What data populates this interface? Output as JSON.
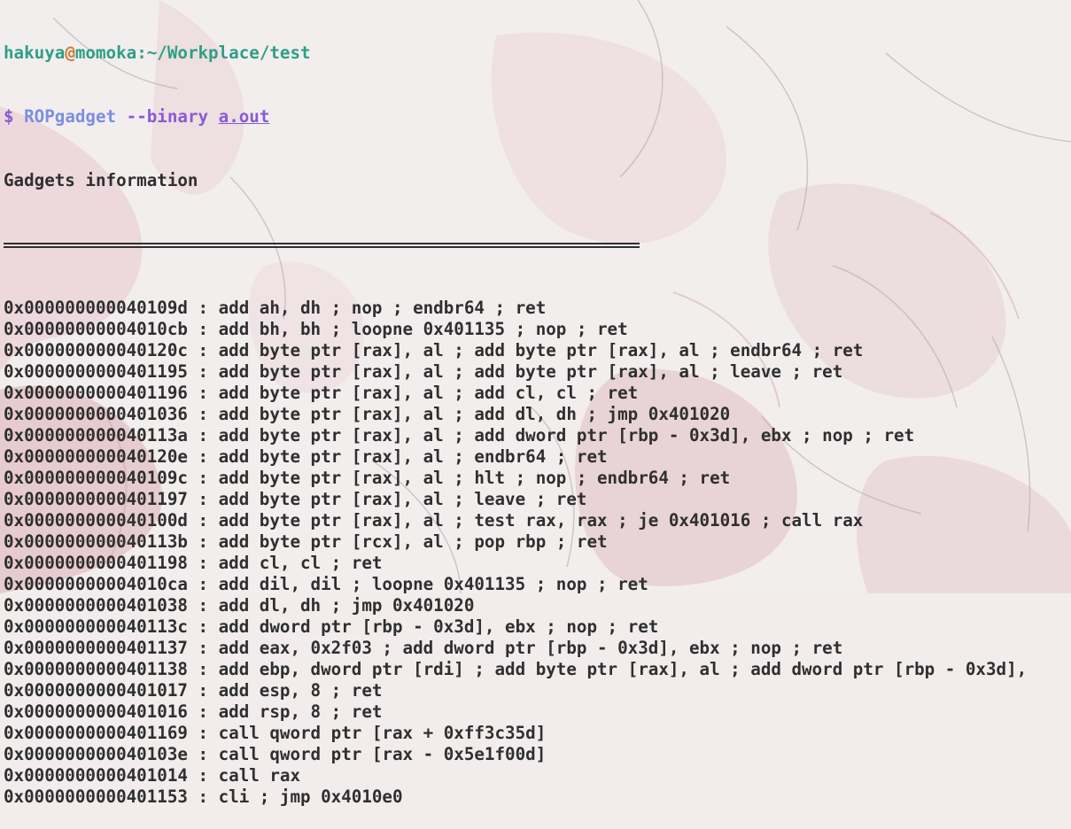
{
  "prompt": {
    "user": "hakuya",
    "at": "@",
    "host": "momoka",
    "colon": ":",
    "path": "~/Workplace/test"
  },
  "command": {
    "dollar": "$",
    "program": "ROPgadget",
    "flag": "--binary",
    "file": "a.out"
  },
  "header": "Gadgets information",
  "gadgets": [
    "0x000000000040109d : add ah, dh ; nop ; endbr64 ; ret",
    "0x00000000004010cb : add bh, bh ; loopne 0x401135 ; nop ; ret",
    "0x000000000040120c : add byte ptr [rax], al ; add byte ptr [rax], al ; endbr64 ; ret",
    "0x0000000000401195 : add byte ptr [rax], al ; add byte ptr [rax], al ; leave ; ret",
    "0x0000000000401196 : add byte ptr [rax], al ; add cl, cl ; ret",
    "0x0000000000401036 : add byte ptr [rax], al ; add dl, dh ; jmp 0x401020",
    "0x000000000040113a : add byte ptr [rax], al ; add dword ptr [rbp - 0x3d], ebx ; nop ; ret",
    "0x000000000040120e : add byte ptr [rax], al ; endbr64 ; ret",
    "0x000000000040109c : add byte ptr [rax], al ; hlt ; nop ; endbr64 ; ret",
    "0x0000000000401197 : add byte ptr [rax], al ; leave ; ret",
    "0x000000000040100d : add byte ptr [rax], al ; test rax, rax ; je 0x401016 ; call rax",
    "0x000000000040113b : add byte ptr [rcx], al ; pop rbp ; ret",
    "0x0000000000401198 : add cl, cl ; ret",
    "0x00000000004010ca : add dil, dil ; loopne 0x401135 ; nop ; ret",
    "0x0000000000401038 : add dl, dh ; jmp 0x401020",
    "0x000000000040113c : add dword ptr [rbp - 0x3d], ebx ; nop ; ret",
    "0x0000000000401137 : add eax, 0x2f03 ; add dword ptr [rbp - 0x3d], ebx ; nop ; ret",
    "0x0000000000401138 : add ebp, dword ptr [rdi] ; add byte ptr [rax], al ; add dword ptr [rbp - 0x3d],",
    "0x0000000000401017 : add esp, 8 ; ret",
    "0x0000000000401016 : add rsp, 8 ; ret",
    "0x0000000000401169 : call qword ptr [rax + 0xff3c35d]",
    "0x000000000040103e : call qword ptr [rax - 0x5e1f00d]",
    "0x0000000000401014 : call rax",
    "0x0000000000401153 : cli ; jmp 0x4010e0"
  ],
  "colors": {
    "prompt_green": "#2d9f86",
    "at_orange": "#d17a2e",
    "purple": "#8a5bd4",
    "command_blue": "#7c8fe0",
    "text": "#2f2f2f",
    "background": "#f2ecec"
  }
}
